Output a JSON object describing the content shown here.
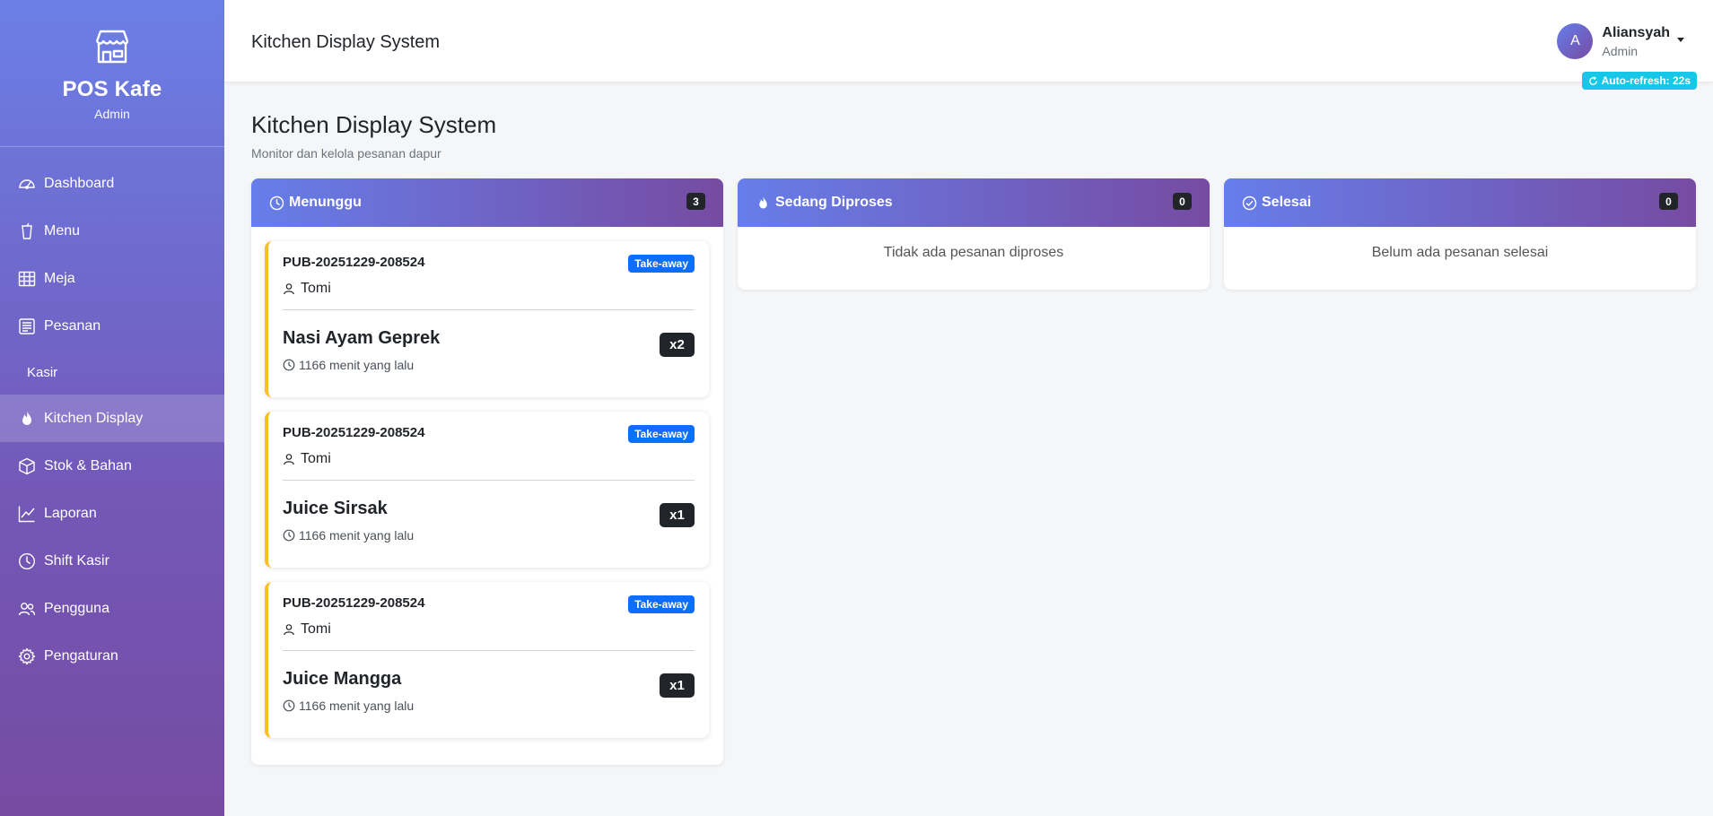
{
  "sidebar": {
    "brand_title": "POS Kafe",
    "brand_sub": "Admin",
    "items": [
      {
        "label": "Dashboard",
        "icon": "speedometer-icon"
      },
      {
        "label": "Menu",
        "icon": "cup-icon"
      },
      {
        "label": "Meja",
        "icon": "table-icon"
      },
      {
        "label": "Pesanan",
        "icon": "receipt-icon"
      },
      {
        "label": "Kasir",
        "icon": ""
      },
      {
        "label": "Kitchen Display",
        "icon": "fire-icon"
      },
      {
        "label": "Stok & Bahan",
        "icon": "box-icon"
      },
      {
        "label": "Laporan",
        "icon": "chart-line-icon"
      },
      {
        "label": "Shift Kasir",
        "icon": "clock-icon"
      },
      {
        "label": "Pengguna",
        "icon": "people-icon"
      },
      {
        "label": "Pengaturan",
        "icon": "gear-icon"
      }
    ],
    "active": "Kitchen Display"
  },
  "header": {
    "title": "Kitchen Display System",
    "user_initial": "A",
    "user_name": "Aliansyah",
    "user_role": "Admin",
    "auto_refresh": "Auto-refresh: 22s"
  },
  "main": {
    "title": "Kitchen Display System",
    "subtitle": "Monitor dan kelola pesanan dapur"
  },
  "columns": {
    "waiting": {
      "title": "Menunggu",
      "count": "3",
      "orders": [
        {
          "id": "PUB-20251229-208524",
          "type": "Take-away",
          "customer": "Tomi",
          "item": "Nasi Ayam Geprek",
          "qty": "x2",
          "time": "1166 menit yang lalu"
        },
        {
          "id": "PUB-20251229-208524",
          "type": "Take-away",
          "customer": "Tomi",
          "item": "Juice Sirsak",
          "qty": "x1",
          "time": "1166 menit yang lalu"
        },
        {
          "id": "PUB-20251229-208524",
          "type": "Take-away",
          "customer": "Tomi",
          "item": "Juice Mangga",
          "qty": "x1",
          "time": "1166 menit yang lalu"
        }
      ]
    },
    "processing": {
      "title": "Sedang Diproses",
      "count": "0",
      "empty": "Tidak ada pesanan diproses"
    },
    "done": {
      "title": "Selesai",
      "count": "0",
      "empty": "Belum ada pesanan selesai"
    }
  },
  "colors": {
    "accent_start": "#667eea",
    "accent_end": "#764ba2",
    "order_border": "#fbbf24",
    "tag_blue": "#0d6efd",
    "refresh_cyan": "#17c7e8"
  }
}
